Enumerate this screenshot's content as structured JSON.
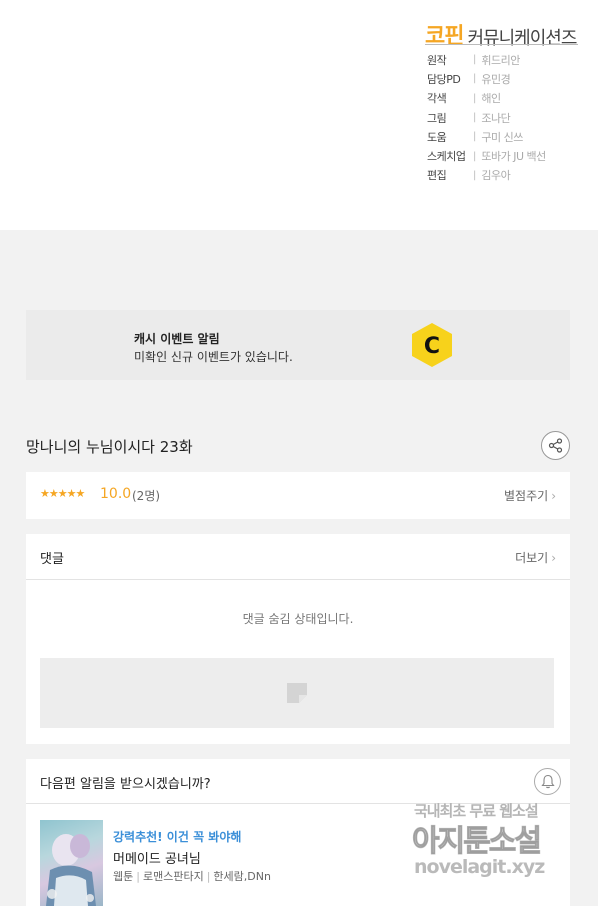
{
  "credits": {
    "logo_main": "코핀",
    "logo_sub": "커뮤니케이션즈",
    "rows": [
      {
        "role": "원작",
        "name": "휘드리안"
      },
      {
        "role": "담당PD",
        "name": "유민경"
      },
      {
        "role": "각색",
        "name": "해인"
      },
      {
        "role": "그림",
        "name": "조나단"
      },
      {
        "role": "도움",
        "name": "구미 신쓰"
      },
      {
        "role": "스케치업",
        "name": "또바가 JU 백선"
      },
      {
        "role": "편집",
        "name": "김우아"
      }
    ]
  },
  "event_banner": {
    "title": "캐시 이벤트 알림",
    "description": "미확인 신규 이벤트가 있습니다.",
    "coin_letter": "C",
    "coin_color": "#f7d21b"
  },
  "episode": {
    "title": "망나니의 누님이시다 23화"
  },
  "rating": {
    "stars": "★★★★★",
    "score": "10.0",
    "count": "(2명)",
    "rate_label": "별점주기"
  },
  "comments": {
    "title": "댓글",
    "more_label": "더보기",
    "hidden_message": "댓글 숨김 상태입니다."
  },
  "notify": {
    "title": "다음편 알림을 받으시겠습니까?"
  },
  "recommendation": {
    "tag": "강력추천! 이건 꼭 봐야해",
    "title": "머메이드 공녀님",
    "meta": [
      "웹툰",
      "로맨스판타지",
      "한세람,DNn"
    ]
  },
  "watermark": {
    "line1": "국내최초 무료 웹소설",
    "line2": "아지툰소설",
    "line3": "novelagit.xyz"
  },
  "chevron": "›"
}
